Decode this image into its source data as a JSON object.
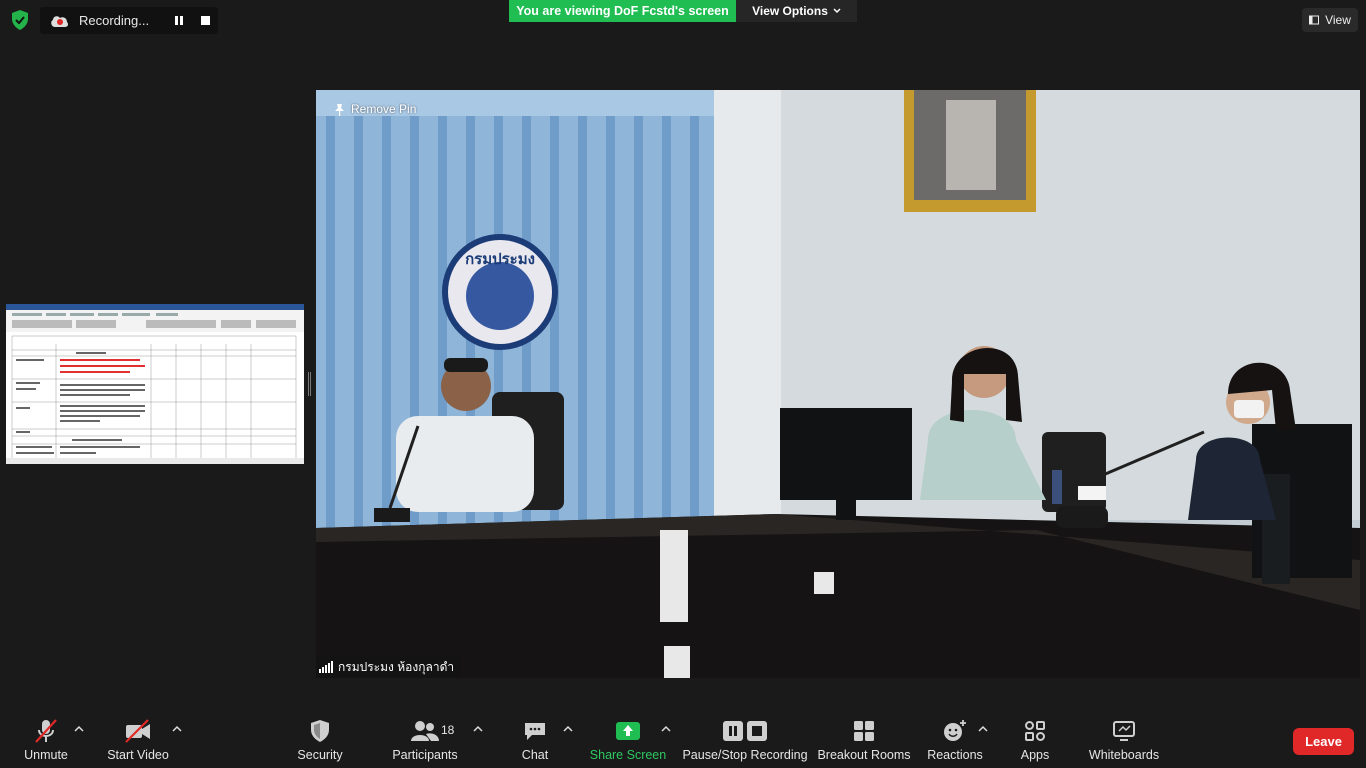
{
  "recording": {
    "status_text": "Recording..."
  },
  "share_banner": {
    "text": "You are viewing DoF Fcstd's screen",
    "view_options_label": "View Options"
  },
  "view_button": {
    "label": "View"
  },
  "video": {
    "remove_pin_label": "Remove Pin",
    "participant_name": "กรมประมง  ห้องกุลาดำ",
    "logo_text": "กรมประมง"
  },
  "toolbar": {
    "unmute": "Unmute",
    "start_video": "Start Video",
    "security": "Security",
    "participants": "Participants",
    "participants_count": "18",
    "chat": "Chat",
    "share_screen": "Share Screen",
    "pause_stop_recording": "Pause/Stop Recording",
    "breakout_rooms": "Breakout Rooms",
    "reactions": "Reactions",
    "apps": "Apps",
    "whiteboards": "Whiteboards",
    "leave": "Leave"
  },
  "colors": {
    "share_green": "#1fbd52",
    "leave_red": "#e02828",
    "muted_red": "#e02828"
  },
  "icons": [
    "shield-icon",
    "cloud-recording-icon",
    "pause-icon",
    "stop-icon",
    "pin-icon",
    "signal-icon",
    "microphone-muted-icon",
    "video-off-icon",
    "participants-icon",
    "chat-icon",
    "share-screen-icon",
    "breakout-rooms-icon",
    "reactions-icon",
    "apps-icon",
    "whiteboard-icon"
  ]
}
